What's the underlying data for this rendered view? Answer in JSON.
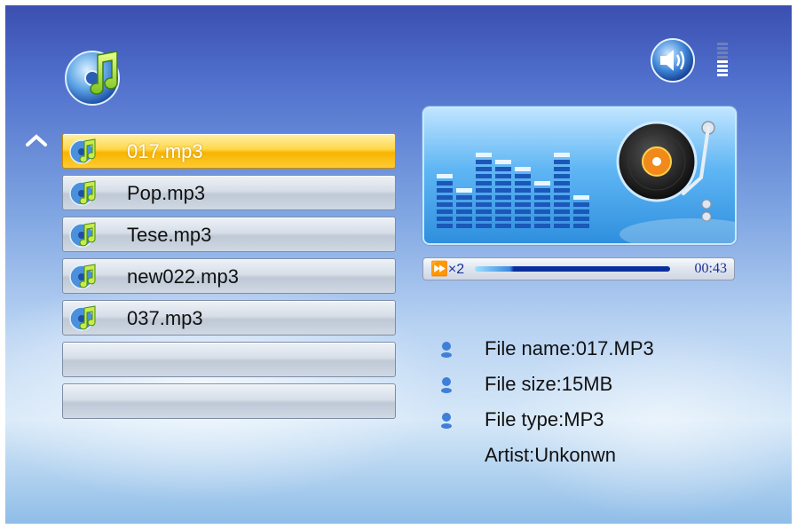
{
  "playlist": {
    "items": [
      {
        "label": "017.mp3",
        "selected": true
      },
      {
        "label": "Pop.mp3",
        "selected": false
      },
      {
        "label": "Tese.mp3",
        "selected": false
      },
      {
        "label": "new022.mp3",
        "selected": false
      },
      {
        "label": "037.mp3",
        "selected": false
      },
      {
        "label": "",
        "selected": false
      },
      {
        "label": "",
        "selected": false
      }
    ]
  },
  "player": {
    "speed": "×2",
    "elapsed": "00:43",
    "progress_fraction": 0.18
  },
  "file_info": {
    "name": "File name:017.MP3",
    "size": "File size:15MB",
    "type": "File type:MP3",
    "artist": "Artist:Unkonwn"
  },
  "icons": {
    "app": "music-note-disc-icon",
    "volume": "speaker-icon",
    "scroll_up": "chevron-up-icon",
    "item": "music-file-icon",
    "bullet": "info-bullet-icon",
    "visual": "turntable-icon"
  },
  "colors": {
    "selected_row": "#ffd74a",
    "row": "#d7dee8",
    "accent_text": "#1c2f9a"
  }
}
